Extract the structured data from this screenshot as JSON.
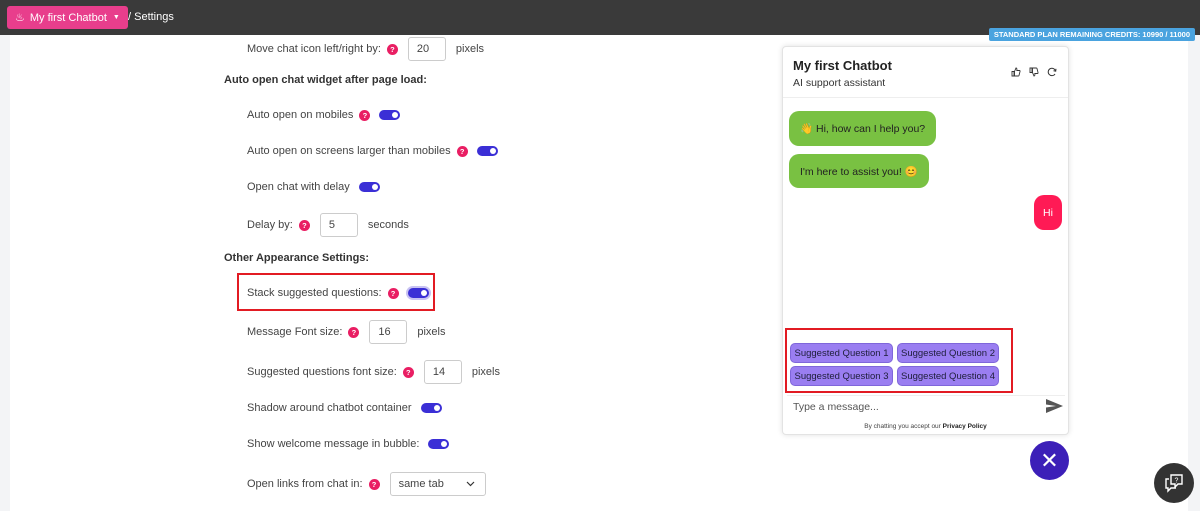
{
  "topbar": {
    "brand_label": "My first Chatbot",
    "breadcrumb": "/ Settings"
  },
  "credits_badge": "STANDARD PLAN REMAINING CREDITS: 10990 / 11000",
  "settings": {
    "move_icon": {
      "label": "Move chat icon left/right by:",
      "value": "20",
      "unit": "pixels"
    },
    "auto_open_heading": "Auto open chat widget after page load:",
    "auto_open_mobiles": {
      "label": "Auto open on mobiles",
      "enabled": true
    },
    "auto_open_larger": {
      "label": "Auto open on screens larger than mobiles",
      "enabled": true
    },
    "open_delay": {
      "label": "Open chat with delay",
      "enabled": true
    },
    "delay_by": {
      "label": "Delay by:",
      "value": "5",
      "unit": "seconds"
    },
    "appearance_heading": "Other Appearance Settings:",
    "stack_suggested": {
      "label": "Stack suggested questions:",
      "enabled": true
    },
    "message_font": {
      "label": "Message Font size:",
      "value": "16",
      "unit": "pixels"
    },
    "suggested_font": {
      "label": "Suggested questions font size:",
      "value": "14",
      "unit": "pixels"
    },
    "shadow": {
      "label": "Shadow around chatbot container",
      "enabled": true
    },
    "welcome_bubble": {
      "label": "Show welcome message in bubble:",
      "enabled": true
    },
    "open_links": {
      "label": "Open links from chat in:",
      "value": "same tab"
    }
  },
  "help_glyph": "?",
  "chat": {
    "title": "My first Chatbot",
    "subtitle": "AI support assistant",
    "bot_messages": [
      "👋 Hi, how can I help you?",
      "I'm here to assist you! 😊"
    ],
    "user_message": "Hi",
    "suggested": [
      "Suggested Question 1",
      "Suggested Question 2",
      "Suggested Question 3",
      "Suggested Question 4"
    ],
    "input_placeholder": "Type a message...",
    "footer_prefix": "By chatting you accept our",
    "footer_link": "Privacy Policy"
  },
  "icons": {
    "brand": "robot-icon",
    "thumbs_up": "thumbs-up-icon",
    "thumbs_down": "thumbs-down-icon",
    "refresh": "refresh-icon",
    "send": "send-icon",
    "close": "close-icon",
    "help_chat": "help-chat-icon"
  },
  "colors": {
    "brand_pink": "#e83e8c",
    "toggle_blue": "#3b2fd6",
    "bot_bubble": "#79c142",
    "user_bubble": "#ff1a55",
    "suggestion": "#9a7ef1",
    "highlight": "#e21b23",
    "close_fab": "#3c1fb8"
  }
}
